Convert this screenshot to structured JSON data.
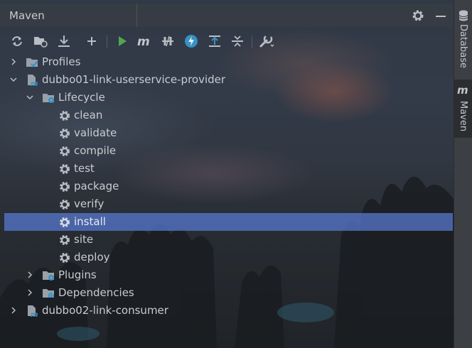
{
  "window": {
    "title": "Maven"
  },
  "header_icons": [
    "gear-icon",
    "minimize-icon"
  ],
  "toolbar": {
    "buttons": [
      {
        "name": "reload-all-projects",
        "icon": "refresh-icon"
      },
      {
        "name": "generate-sources",
        "icon": "folder-refresh-icon"
      },
      {
        "name": "download-sources",
        "icon": "download-icon"
      },
      {
        "name": "add-maven-project",
        "icon": "plus-icon"
      },
      {
        "name": "run-maven-build",
        "icon": "run-icon",
        "color": "#4fa84f"
      },
      {
        "name": "execute-maven-goal",
        "icon": "maven-m-icon"
      },
      {
        "name": "toggle-offline-mode",
        "icon": "offline-icon"
      },
      {
        "name": "skip-tests-mode",
        "icon": "lightning-icon",
        "color": "#3592c4"
      },
      {
        "name": "show-dependencies",
        "icon": "expand-all-icon"
      },
      {
        "name": "collapse-all",
        "icon": "collapse-all-icon"
      },
      {
        "name": "maven-settings",
        "icon": "wrench-icon"
      }
    ]
  },
  "tree": {
    "items": [
      {
        "label": "Profiles",
        "icon": "profiles-folder-icon",
        "arrow": "right"
      },
      {
        "label": "dubbo01-link-userservice-provider",
        "icon": "maven-project-icon",
        "arrow": "down"
      },
      {
        "label": "Lifecycle",
        "icon": "lifecycle-folder-icon",
        "arrow": "down"
      },
      {
        "label": "clean",
        "icon": "gear-icon"
      },
      {
        "label": "validate",
        "icon": "gear-icon"
      },
      {
        "label": "compile",
        "icon": "gear-icon"
      },
      {
        "label": "test",
        "icon": "gear-icon"
      },
      {
        "label": "package",
        "icon": "gear-icon"
      },
      {
        "label": "verify",
        "icon": "gear-icon"
      },
      {
        "label": "install",
        "icon": "gear-icon",
        "selected": true
      },
      {
        "label": "site",
        "icon": "gear-icon"
      },
      {
        "label": "deploy",
        "icon": "gear-icon"
      },
      {
        "label": "Plugins",
        "icon": "plugins-folder-icon",
        "arrow": "right"
      },
      {
        "label": "Dependencies",
        "icon": "dependencies-folder-icon",
        "arrow": "right"
      },
      {
        "label": "dubbo02-link-consumer",
        "icon": "maven-project-icon",
        "arrow": "right"
      }
    ]
  },
  "sidebar": {
    "tabs": [
      {
        "label": "Database",
        "icon": "database-icon"
      },
      {
        "label": "Maven",
        "icon": "maven-m-icon",
        "active": true
      }
    ]
  },
  "colors": {
    "selection": "#5474c8",
    "run_green": "#4fa84f",
    "accent_blue": "#3592c4"
  }
}
